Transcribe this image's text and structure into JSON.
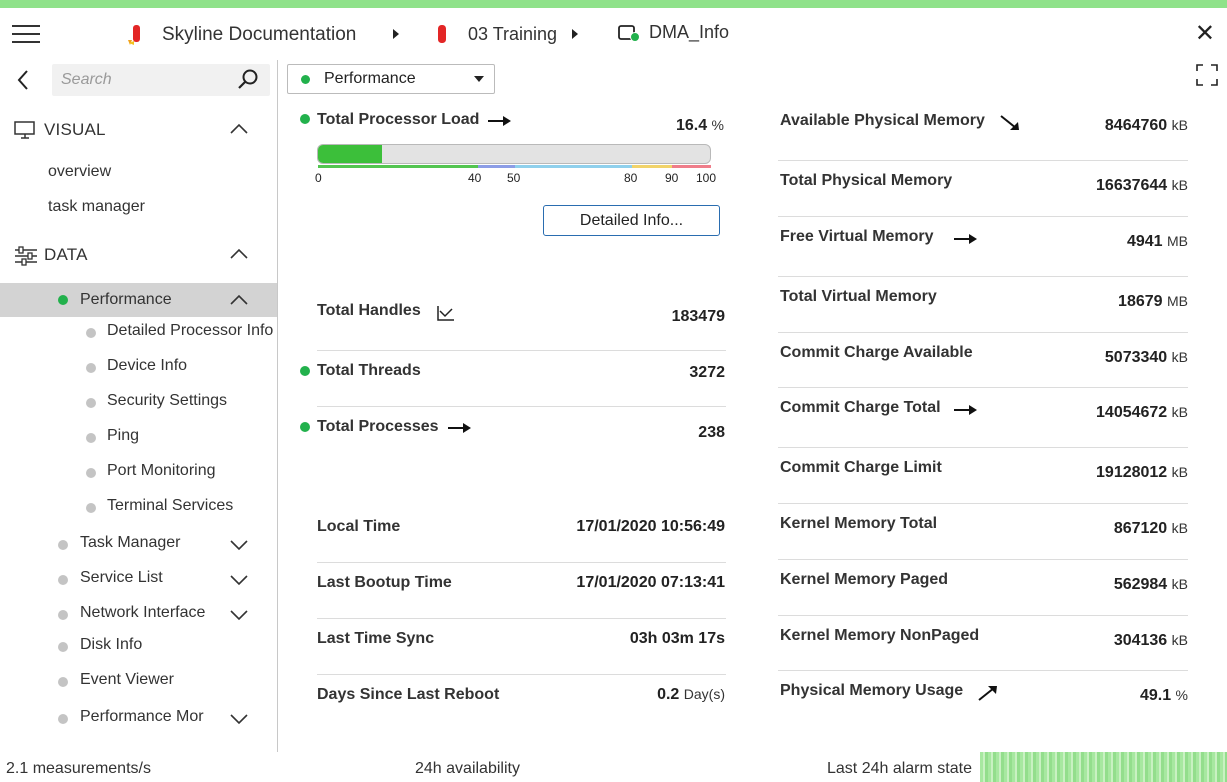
{
  "header": {
    "breadcrumbs": [
      {
        "label": "Skyline Documentation",
        "icon": "view-icon"
      },
      {
        "label": "03 Training",
        "icon": "view-icon"
      },
      {
        "label": "DMA_Info",
        "icon": "element-icon"
      }
    ]
  },
  "sidebar": {
    "search_placeholder": "Search",
    "sections": {
      "visual": {
        "label": "VISUAL",
        "items": [
          "overview",
          "task manager"
        ]
      },
      "data": {
        "label": "DATA"
      }
    },
    "pages": [
      {
        "label": "Performance",
        "status": "green",
        "expanded": true,
        "selected": true,
        "children": [
          "Detailed Processor Info",
          "Device Info",
          "Security Settings",
          "Ping",
          "Port Monitoring",
          "Terminal Services"
        ]
      },
      {
        "label": "Task Manager",
        "expandable": true
      },
      {
        "label": "Service List",
        "expandable": true
      },
      {
        "label": "Network Interface",
        "expandable": true
      },
      {
        "label": "Disk Info"
      },
      {
        "label": "Event Viewer"
      },
      {
        "label": "Performance Mor",
        "expandable": true
      }
    ]
  },
  "main": {
    "page_selector": "Performance",
    "processor": {
      "label": "Total Processor Load",
      "value": "16.4",
      "unit": "%",
      "fill_fraction": 0.164,
      "ticks": [
        "0",
        "40",
        "50",
        "80",
        "90",
        "100"
      ],
      "detail_button": "Detailed Info..."
    },
    "left_params": [
      {
        "label": "Total Handles",
        "value": "183479",
        "unit": ""
      },
      {
        "label": "Total Threads",
        "value": "3272",
        "unit": ""
      },
      {
        "label": "Total Processes",
        "value": "238",
        "unit": ""
      }
    ],
    "time_params": [
      {
        "label": "Local Time",
        "value": "17/01/2020 10:56:49",
        "unit": ""
      },
      {
        "label": "Last Bootup Time",
        "value": "17/01/2020 07:13:41",
        "unit": ""
      },
      {
        "label": "Last Time Sync",
        "value": "03h 03m 17s",
        "unit": ""
      },
      {
        "label": "Days Since Last Reboot",
        "value": "0.2",
        "unit": "Day(s)"
      }
    ],
    "right_params": [
      {
        "label": "Available Physical Memory",
        "value": "8464760",
        "unit": "kB"
      },
      {
        "label": "Total Physical Memory",
        "value": "16637644",
        "unit": "kB"
      },
      {
        "label": "Free Virtual Memory",
        "value": "4941",
        "unit": "MB"
      },
      {
        "label": "Total Virtual Memory",
        "value": "18679",
        "unit": "MB"
      },
      {
        "label": "Commit Charge Available",
        "value": "5073340",
        "unit": "kB"
      },
      {
        "label": "Commit Charge Total",
        "value": "14054672",
        "unit": "kB"
      },
      {
        "label": "Commit Charge Limit",
        "value": "19128012",
        "unit": "kB"
      },
      {
        "label": "Kernel Memory Total",
        "value": "867120",
        "unit": "kB"
      },
      {
        "label": "Kernel Memory Paged",
        "value": "562984",
        "unit": "kB"
      },
      {
        "label": "Kernel Memory NonPaged",
        "value": "304136",
        "unit": "kB"
      },
      {
        "label": "Physical Memory Usage",
        "value": "49.1",
        "unit": "%"
      }
    ]
  },
  "footer": {
    "rate": "2.1 measurements/s",
    "availability": "24h availability",
    "alarm_state": "Last 24h alarm state"
  },
  "colors": {
    "accent_green": "#22b14c",
    "top_stripe": "#8fe28a",
    "button_border": "#2a6db0"
  }
}
